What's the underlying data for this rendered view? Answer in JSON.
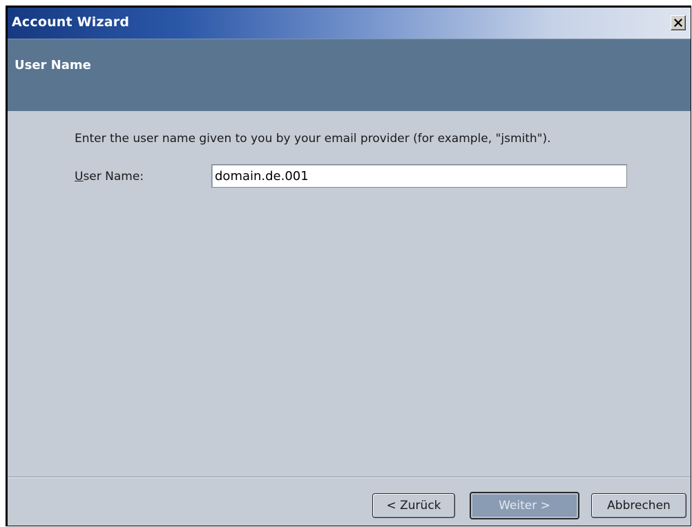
{
  "window": {
    "title": "Account Wizard",
    "close_icon": "close-icon"
  },
  "header": {
    "title": "User Name"
  },
  "body": {
    "instruction": "Enter the user name given to you by your email provider (for example, \"jsmith\").",
    "username_label_accel": "U",
    "username_label_rest": "ser Name:",
    "username_value": "domain.de.001"
  },
  "buttons": {
    "back": "< Zurück",
    "next": "Weiter >",
    "cancel": "Abbrechen"
  },
  "colors": {
    "titlebar_start": "#163a82",
    "header_panel": "#5a7590",
    "dialog_bg": "#c6ccd6"
  }
}
